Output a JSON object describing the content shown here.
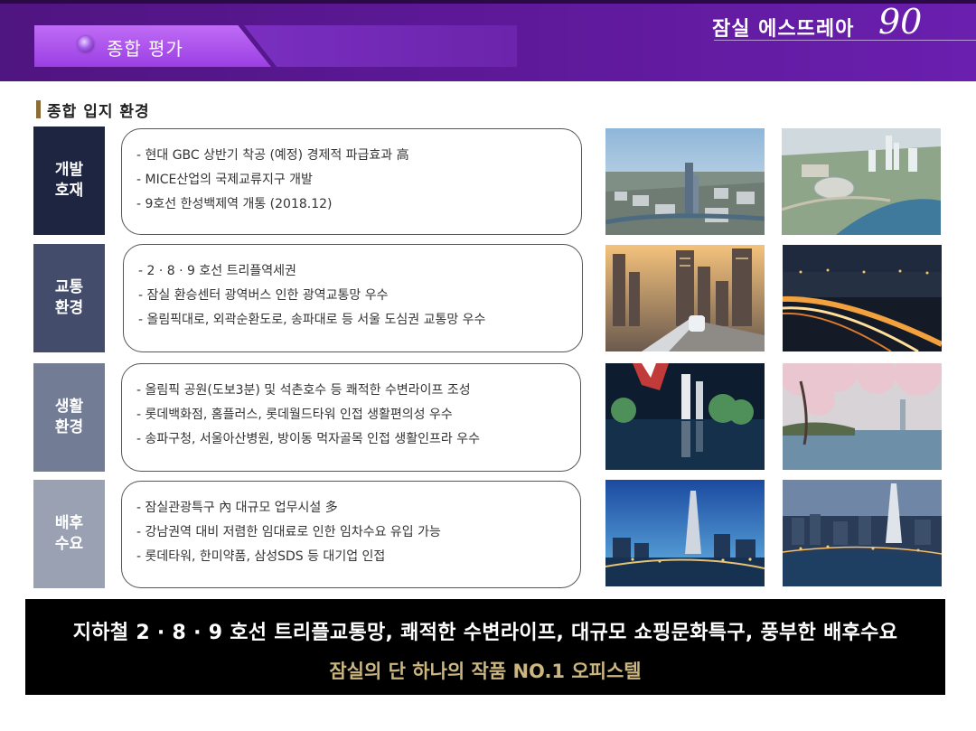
{
  "header": {
    "section_title": "종합 평가",
    "section_icon": "purple-orb-icon",
    "brand_name": "잠실 에스뜨레아",
    "brand_number": "90"
  },
  "subtitle": "종합 입지 환경",
  "colors": {
    "header_purple": "#5c1896",
    "tab_purple": "#b060f0",
    "navy": "#1d2540",
    "slate": "#434c6a",
    "gray_blue": "#737c95",
    "light_gray": "#9aa1b2",
    "gold": "#cbb67f"
  },
  "categories": [
    {
      "label": "개발\n호재",
      "lines": [
        "- 현대 GBC 상반기 착공 (예정) 경제적 파급효과 高",
        "- MICE산업의 국제교류지구 개발",
        "- 9호선 한성백제역 개통 (2018.12)"
      ]
    },
    {
      "label": "교통\n환경",
      "lines": [
        "- 2 · 8 · 9 호선 트리플역세권",
        "- 잠실 환승센터 광역버스 인한 광역교통망 우수",
        "- 올림픽대로, 외곽순환도로, 송파대로 등 서울 도심권 교통망 우수"
      ]
    },
    {
      "label": "생활\n환경",
      "lines": [
        "- 올림픽 공원(도보3분) 및 석촌호수 등 쾌적한 수변라이프 조성",
        "- 롯데백화점, 홈플러스, 롯데월드타워 인접 생활편의성 우수",
        "- 송파구청, 서울아산병원, 방이동 먹자골목 인접 생활인프라 우수"
      ]
    },
    {
      "label": "배후\n수요",
      "lines": [
        "- 잠실관광특구 內 대규모 업무시설 多",
        "- 강남권역 대비 저렴한 임대료로 인한 임차수요 유입 가능",
        "- 롯데타워, 한미약품, 삼성SDS 등 대기업 인접"
      ]
    }
  ],
  "photos": [
    "gbc-aerial-photo",
    "mice-complex-rendering",
    "metro-train-photo",
    "highway-night-photo",
    "olympic-park-night-photo",
    "cherry-blossom-lake-photo",
    "lotte-tower-dusk-photo",
    "lotte-tower-aerial-photo"
  ],
  "banner": {
    "line1": "지하철 2 · 8 · 9 호선 트리플교통망, 쾌적한 수변라이프, 대규모 쇼핑문화특구, 풍부한 배후수요",
    "line2": "잠실의 단 하나의 작품 NO.1 오피스텔"
  }
}
